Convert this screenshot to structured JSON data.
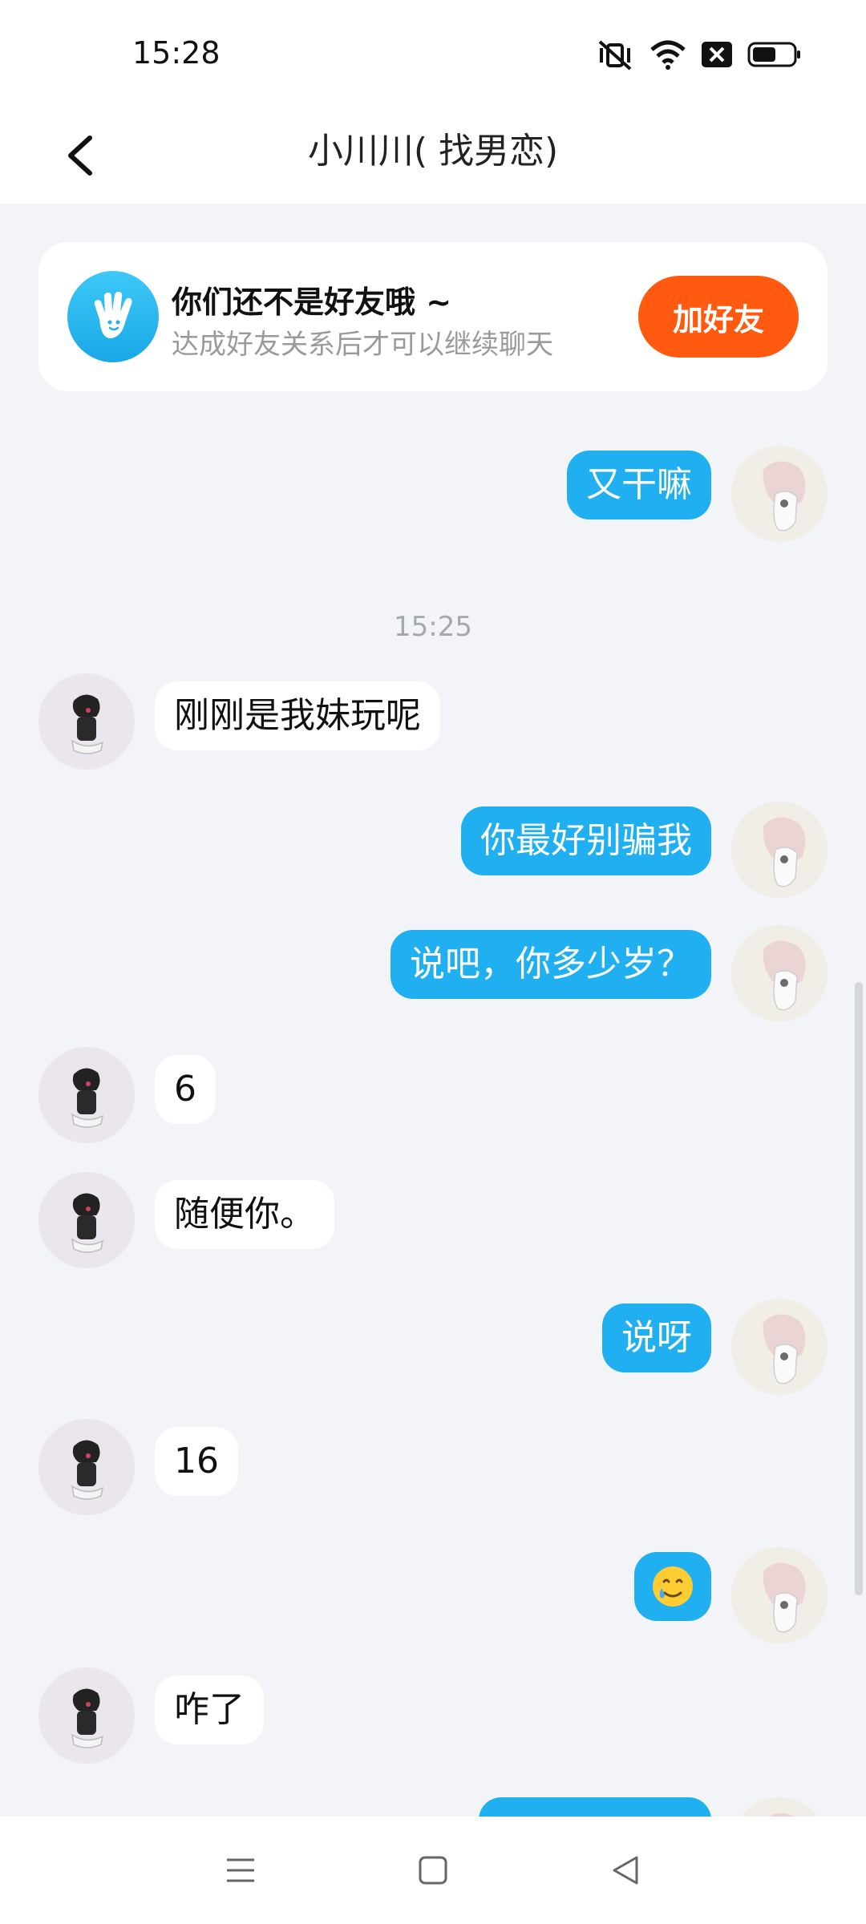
{
  "status_bar": {
    "time": "15:28",
    "icons": [
      "vibrate-off-icon",
      "wifi-icon",
      "data-off-icon",
      "battery-icon"
    ]
  },
  "header": {
    "title": "小川川( 找男恋)",
    "back_icon": "chevron-left-icon"
  },
  "friend_banner": {
    "title": "你们还不是好友哦 ~",
    "subtitle": "达成好友关系后才可以继续聊天",
    "button_label": "加好友",
    "icon": "hand-wave-icon",
    "accent": "#ff5a10"
  },
  "messages": [
    {
      "direction": "out",
      "text": "又干嘛"
    },
    {
      "type": "time",
      "text": "15:25"
    },
    {
      "direction": "in",
      "text": "刚刚是我妹玩呢"
    },
    {
      "direction": "out",
      "text": "你最好别骗我"
    },
    {
      "direction": "out",
      "text": "说吧，你多少岁？"
    },
    {
      "direction": "in",
      "text": "6"
    },
    {
      "direction": "in",
      "text": "随便你。"
    },
    {
      "direction": "out",
      "text": "说呀"
    },
    {
      "direction": "in",
      "text": "16"
    },
    {
      "direction": "out",
      "emoji": "smiling-face-with-tear-icon"
    },
    {
      "direction": "in",
      "text": "咋了"
    }
  ],
  "colors": {
    "outgoing_bubble": "#20b0f2",
    "incoming_bubble": "#ffffff",
    "chat_background": "#f2f4f7"
  },
  "nav_bar": {
    "icons": [
      "menu-icon",
      "home-icon",
      "back-icon"
    ]
  }
}
